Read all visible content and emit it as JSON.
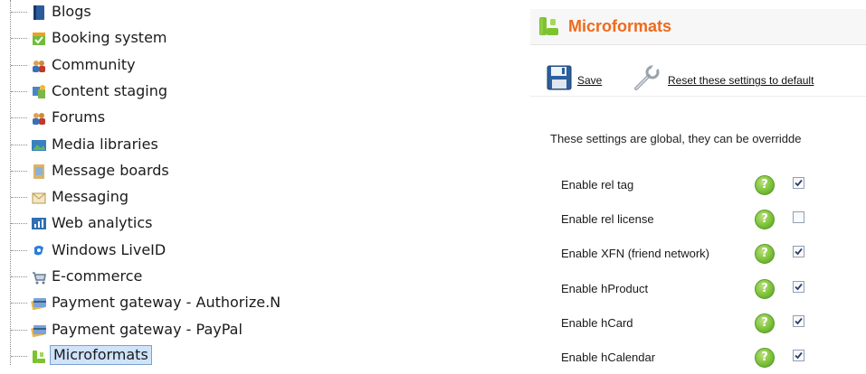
{
  "tree": {
    "items": [
      {
        "label": "Blogs",
        "icon": "blog-icon"
      },
      {
        "label": "Booking system",
        "icon": "booking-icon"
      },
      {
        "label": "Community",
        "icon": "community-icon"
      },
      {
        "label": "Content staging",
        "icon": "content-staging-icon"
      },
      {
        "label": "Forums",
        "icon": "forums-icon"
      },
      {
        "label": "Media libraries",
        "icon": "media-libraries-icon"
      },
      {
        "label": "Message boards",
        "icon": "message-boards-icon"
      },
      {
        "label": "Messaging",
        "icon": "messaging-icon"
      },
      {
        "label": "Web analytics",
        "icon": "web-analytics-icon"
      },
      {
        "label": "Windows LiveID",
        "icon": "windows-liveid-icon"
      },
      {
        "label": "E-commerce",
        "icon": "ecommerce-icon"
      },
      {
        "label": "Payment gateway - Authorize.N",
        "icon": "payment-gateway-icon"
      },
      {
        "label": "Payment gateway - PayPal",
        "icon": "payment-gateway-icon"
      },
      {
        "label": "Microformats",
        "icon": "microformats-icon",
        "selected": true
      }
    ]
  },
  "panel": {
    "title": "Microformats",
    "title_color": "#ee6a1c",
    "toolbar": {
      "save_label": "Save",
      "reset_label": "Reset these settings to default"
    },
    "info_text": "These settings are global, they can be overridde",
    "settings": [
      {
        "label": "Enable rel tag",
        "checked": true
      },
      {
        "label": "Enable rel license",
        "checked": false
      },
      {
        "label": "Enable XFN (friend network)",
        "checked": true
      },
      {
        "label": "Enable hProduct",
        "checked": true
      },
      {
        "label": "Enable hCard",
        "checked": true
      },
      {
        "label": "Enable hCalendar",
        "checked": true
      }
    ],
    "help_glyph": "?"
  }
}
